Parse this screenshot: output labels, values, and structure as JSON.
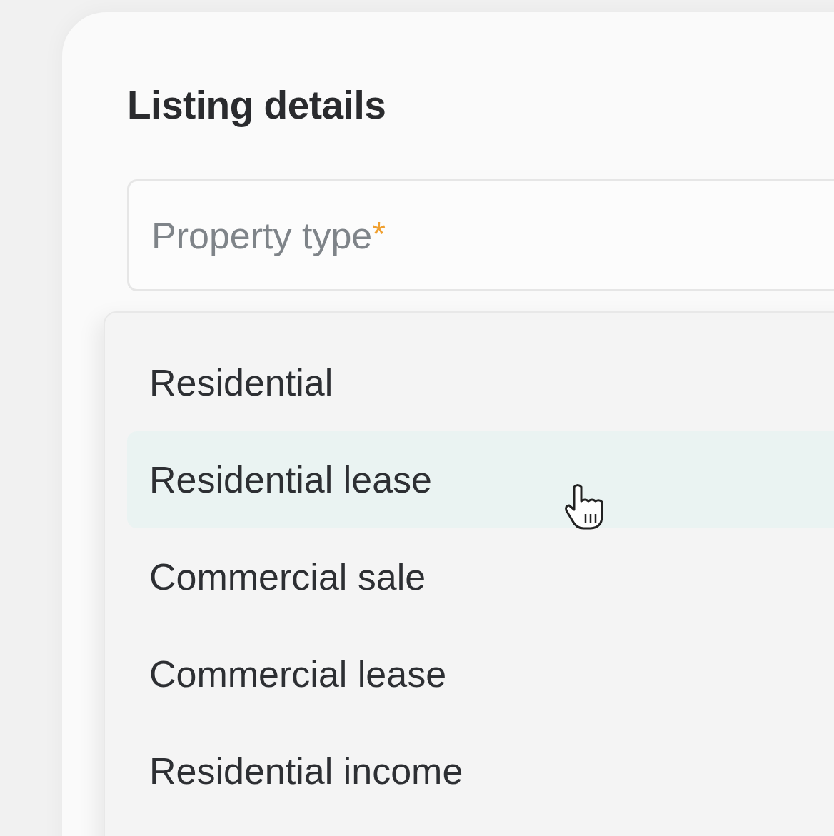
{
  "card": {
    "title": "Listing details"
  },
  "field": {
    "placeholder": "Property type",
    "required_mark": "*"
  },
  "options": [
    {
      "label": "Residential",
      "selected": false
    },
    {
      "label": "Residential lease",
      "selected": true
    },
    {
      "label": "Commercial sale",
      "selected": false
    },
    {
      "label": "Commercial lease",
      "selected": false
    },
    {
      "label": "Residential income",
      "selected": false
    }
  ]
}
